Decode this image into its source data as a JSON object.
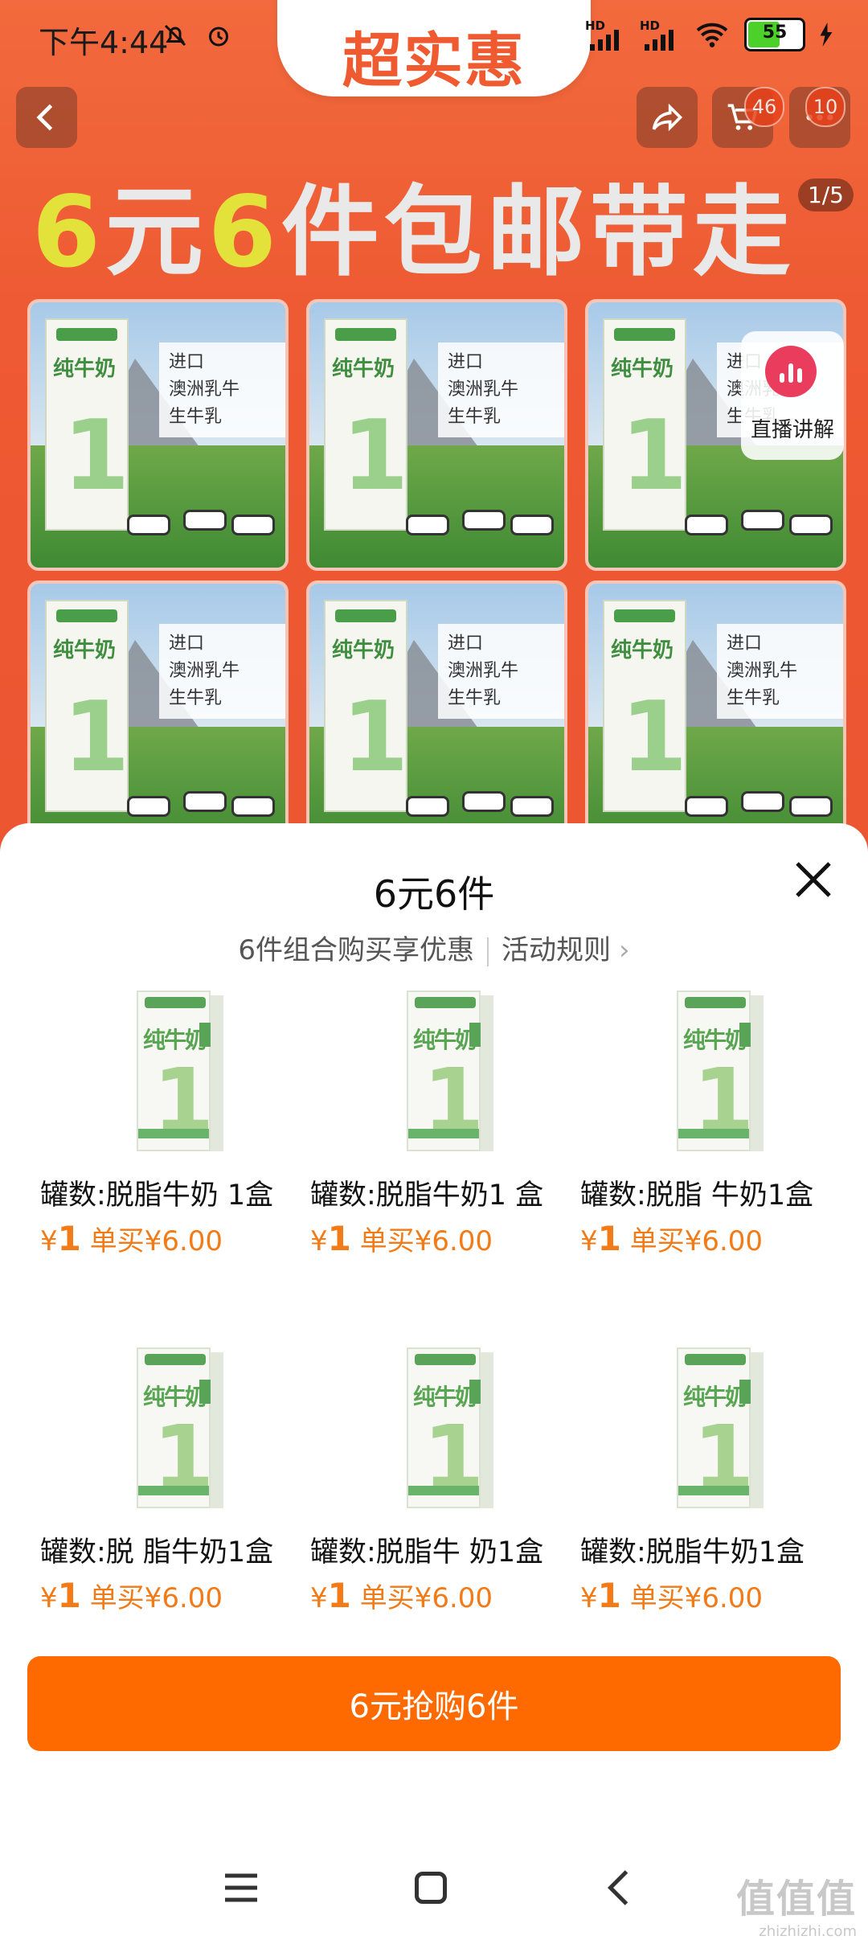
{
  "status": {
    "time": "下午4:44",
    "battery": "55",
    "hd1": "HD",
    "hd2": "HD"
  },
  "header": {
    "tab_badge": "超实惠",
    "cart_count": "46",
    "more_count": "10",
    "headline_a": "6",
    "headline_b": "元",
    "headline_c": "6",
    "headline_d": "件包邮带走",
    "pager": "1/5",
    "card_label": [
      "进口",
      "澳洲乳牛",
      "生牛乳"
    ],
    "live_label": "直播讲解"
  },
  "sheet": {
    "title": "6元6件",
    "subtitle": "6件组合购买享优惠",
    "rules_link": "活动规则",
    "items": [
      {
        "name": "罐数:脱脂牛奶 1盒",
        "price_symbol": "¥",
        "price": "1",
        "single": "单买¥6.00"
      },
      {
        "name": "罐数:脱脂牛奶1 盒",
        "price_symbol": "¥",
        "price": "1",
        "single": "单买¥6.00"
      },
      {
        "name": "罐数:脱脂 牛奶1盒",
        "price_symbol": "¥",
        "price": "1",
        "single": "单买¥6.00"
      },
      {
        "name": "罐数:脱 脂牛奶1盒",
        "price_symbol": "¥",
        "price": "1",
        "single": "单买¥6.00"
      },
      {
        "name": "罐数:脱脂牛 奶1盒",
        "price_symbol": "¥",
        "price": "1",
        "single": "单买¥6.00"
      },
      {
        "name": "罐数:脱脂牛奶1盒",
        "price_symbol": "¥",
        "price": "1",
        "single": "单买¥6.00"
      }
    ],
    "pack_text": "纯牛奶",
    "pack_one": "1",
    "buy_button": "6元抢购6件"
  },
  "watermark": {
    "line1": "值值值",
    "line2": "zhizhizhi.com"
  },
  "colors": {
    "accent": "#ff6a00",
    "price": "#f27a17",
    "hero": "#ee5a33"
  }
}
